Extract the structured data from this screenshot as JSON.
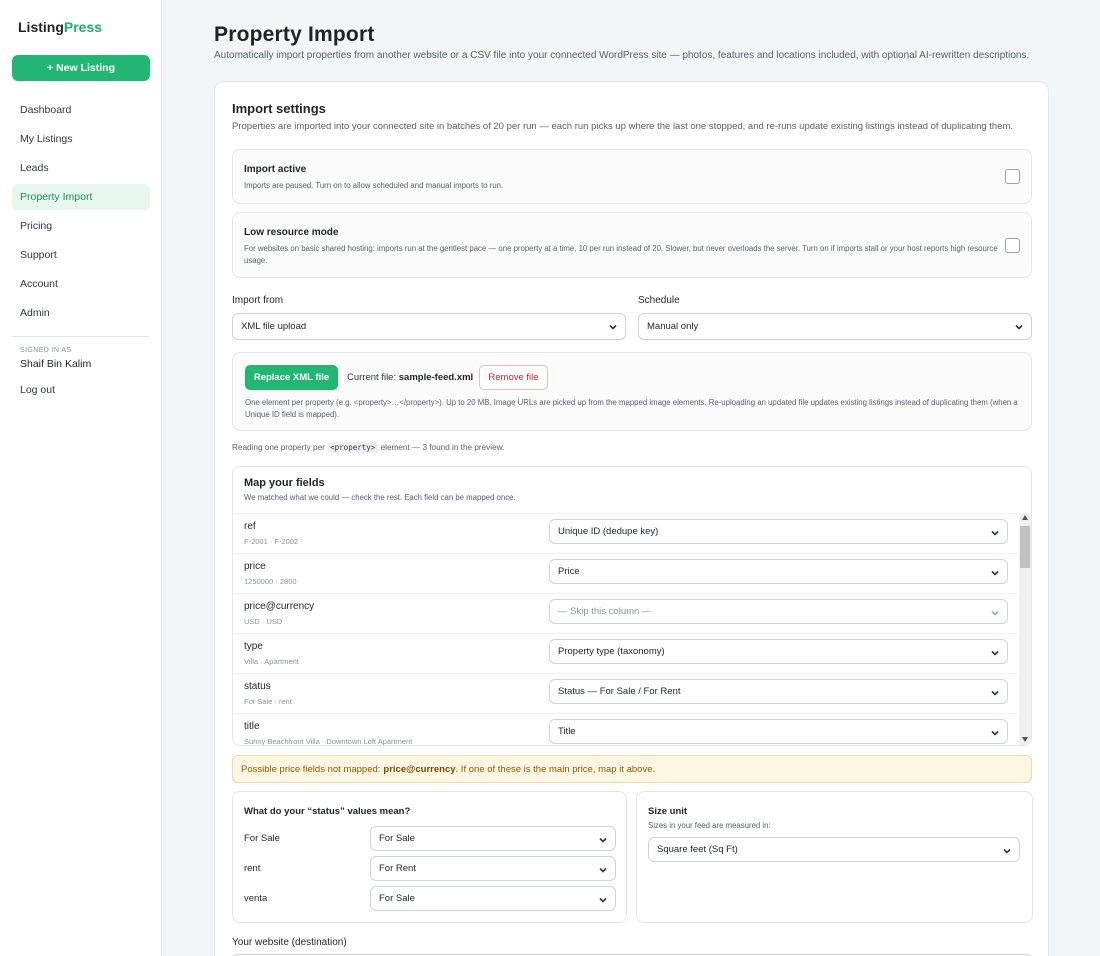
{
  "app": {
    "logo_main": "Listing",
    "logo_accent": "Press",
    "new_listing": "+ New Listing",
    "accent_color": "#22b573"
  },
  "sidebar": {
    "items": [
      {
        "label": "Dashboard"
      },
      {
        "label": "My Listings"
      },
      {
        "label": "Leads"
      },
      {
        "label": "Property Import",
        "active": true
      },
      {
        "label": "Pricing"
      },
      {
        "label": "Support"
      },
      {
        "label": "Account"
      },
      {
        "label": "Admin"
      }
    ],
    "signed_in_label": "SIGNED IN AS",
    "user_name": "Shaif Bin Kalim",
    "logout": "Log out"
  },
  "header": {
    "title": "Property Import",
    "subtitle": "Automatically import properties from another website or a CSV file into your connected WordPress site — photos, features and locations included, with optional AI-rewritten descriptions."
  },
  "settings": {
    "title": "Import settings",
    "subtitle": "Properties are imported into your connected site in batches of 20 per run — each run picks up where the last one stopped, and re-runs update existing listings instead of duplicating them.",
    "import_active": {
      "title": "Import active",
      "desc": "Imports are paused. Turn on to allow scheduled and manual imports to run.",
      "checked": false
    },
    "low_resource": {
      "title": "Low resource mode",
      "desc": "For websites on basic shared hosting: imports run at the gentlest pace — one property at a time, 10 per run instead of 20. Slower, but never overloads the server. Turn on if imports stall or your host reports high resource usage.",
      "checked": false
    },
    "import_from": {
      "label": "Import from",
      "value": "XML file upload"
    },
    "schedule": {
      "label": "Schedule",
      "value": "Manual only"
    }
  },
  "upload": {
    "replace_btn": "Replace XML file",
    "current_file_label": "Current file:",
    "current_file_name": "sample-feed.xml",
    "remove_btn": "Remove file",
    "desc": "One element per property (e.g. <property>…</property>). Up to 20 MB. Image URLs are picked up from the mapped image elements. Re-uploading an updated file updates existing listings instead of duplicating them (when a Unique ID field is mapped)."
  },
  "reading": {
    "prefix": "Reading one property per",
    "tag": "<property>",
    "suffix": "element — 3 found in the preview."
  },
  "mapping": {
    "title": "Map your fields",
    "subtitle": "We matched what we could — check the rest. Each field can be mapped once.",
    "rows": [
      {
        "name": "ref",
        "sample": "F-2001 · F-2002",
        "value": "Unique ID (dedupe key)",
        "skipped": false
      },
      {
        "name": "price",
        "sample": "1250000 · 2800",
        "value": "Price",
        "skipped": false
      },
      {
        "name": "price@currency",
        "sample": "USD · USD",
        "value": "— Skip this column —",
        "skipped": true
      },
      {
        "name": "type",
        "sample": "Villa · Apartment",
        "value": "Property type (taxonomy)",
        "skipped": false
      },
      {
        "name": "status",
        "sample": "For Sale · rent",
        "value": "Status — For Sale / For Rent",
        "skipped": false
      },
      {
        "name": "title",
        "sample": "Sunny Beachfront Villa · Downtown Loft Apartment",
        "value": "Title",
        "skipped": false
      }
    ]
  },
  "warning": {
    "prefix": "Possible price fields not mapped:",
    "field": "price@currency",
    "suffix": ". If one of these is the main price, map it above."
  },
  "status_map": {
    "title": "What do your “status” values mean?",
    "rows": [
      {
        "name": "For Sale",
        "value": "For Sale"
      },
      {
        "name": "rent",
        "value": "For Rent"
      },
      {
        "name": "venta",
        "value": "For Sale"
      }
    ]
  },
  "size_unit": {
    "title": "Size unit",
    "subtitle": "Sizes in your feed are measured in:",
    "value": "Square feet (Sq Ft)"
  },
  "destination": {
    "label": "Your website (destination)"
  }
}
